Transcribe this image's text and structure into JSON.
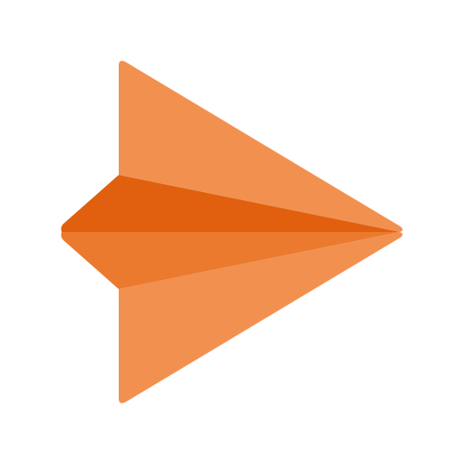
{
  "icon": {
    "name": "paper-plane-icon",
    "colors": {
      "background": "#ffffff",
      "wing_light": "#F2914F",
      "fold_dark": "#E0600F",
      "fold_mid": "#EB7A2E"
    }
  }
}
